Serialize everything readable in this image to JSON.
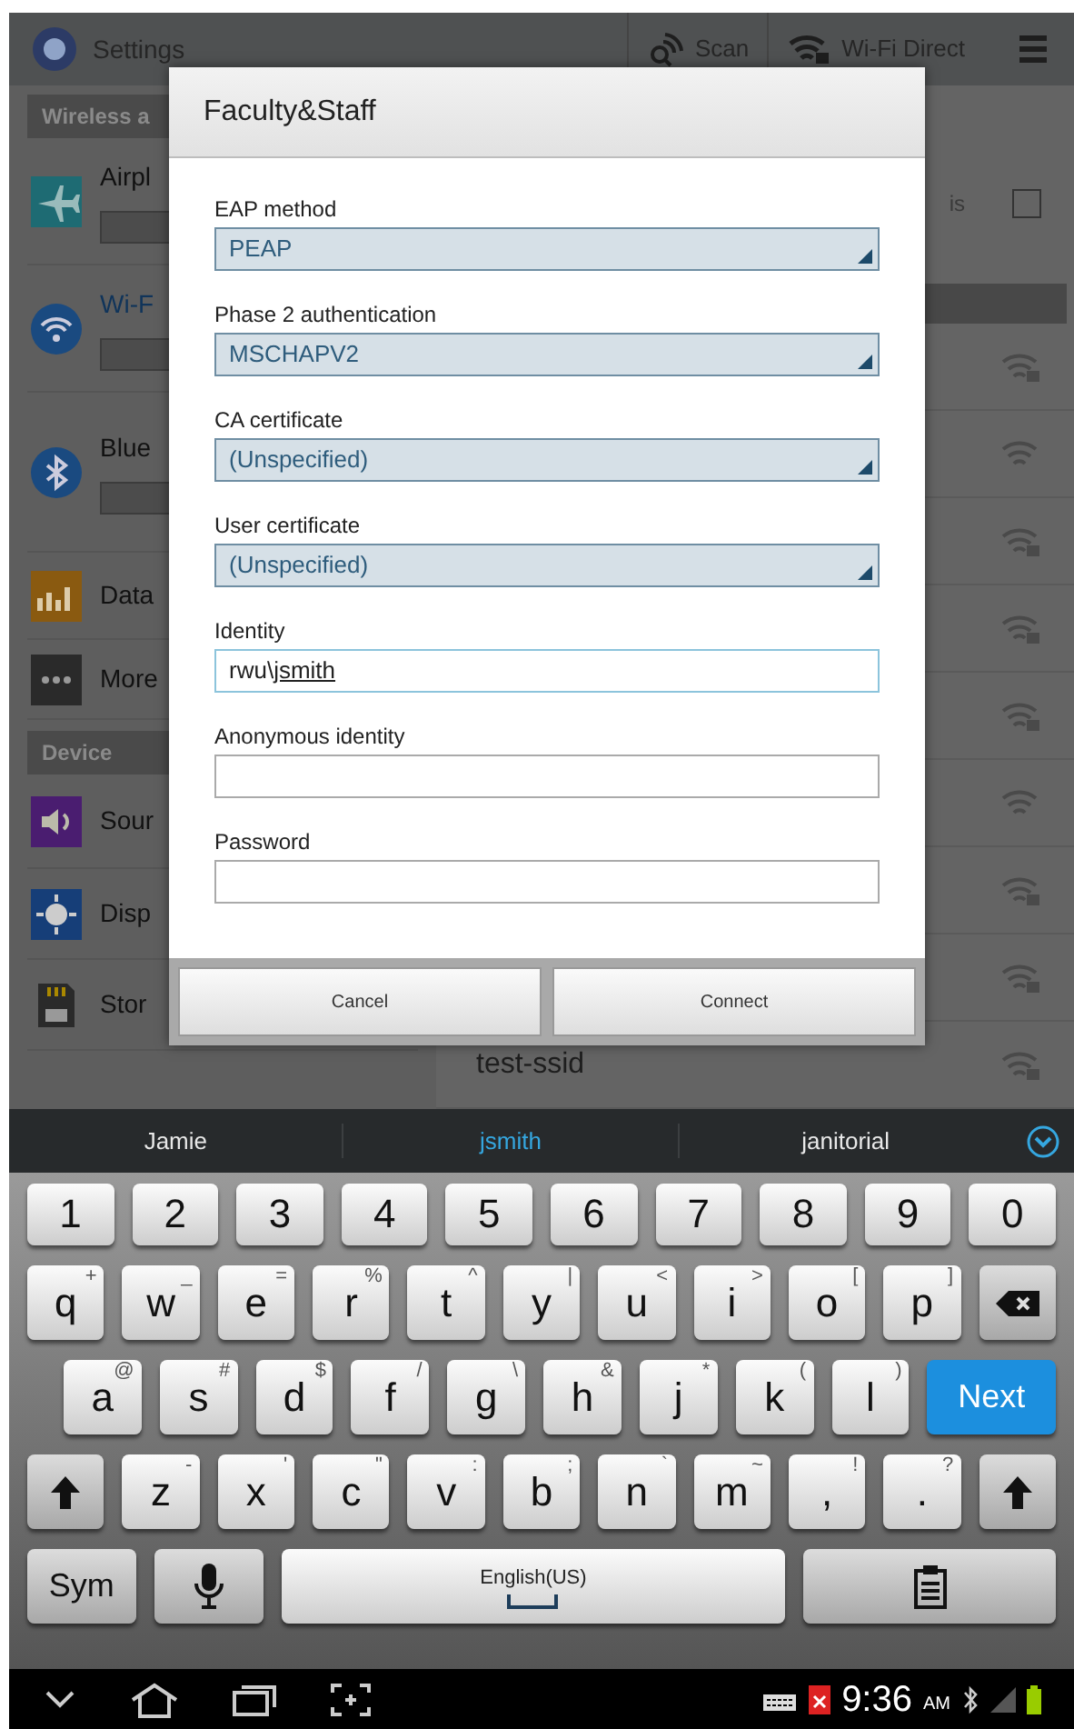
{
  "action_bar": {
    "title": "Settings",
    "actions": [
      {
        "kind": "scan",
        "label": "Scan"
      },
      {
        "kind": "wifi_direct",
        "label": "Wi-Fi Direct"
      }
    ]
  },
  "left_panel": {
    "sections": [
      {
        "header": "Wireless a",
        "items": [
          {
            "kind": "airplane",
            "label": "Airpl",
            "toggle": {
              "on": false
            }
          },
          {
            "kind": "wifi",
            "label": "Wi-F",
            "toggle": {
              "on": false
            }
          },
          {
            "kind": "bluetooth",
            "label": "Blue",
            "toggle": {
              "on": false
            }
          },
          {
            "kind": "data",
            "label": "Data"
          },
          {
            "kind": "more",
            "label": "More"
          }
        ]
      },
      {
        "header": "Device",
        "items": [
          {
            "kind": "sound",
            "label": "Sour"
          },
          {
            "kind": "display",
            "label": "Disp"
          },
          {
            "kind": "storage",
            "label": "Stor"
          }
        ]
      }
    ]
  },
  "right_panel": {
    "option": {
      "label": "is",
      "checked": false
    },
    "networks": [
      {
        "secured": true
      },
      {
        "secured": false
      },
      {
        "secured": true
      },
      {
        "secured": true
      },
      {
        "secured": true
      },
      {
        "secured": false
      },
      {
        "secured": true
      },
      {
        "secured": true
      },
      {
        "name": "test-ssid",
        "secured": true
      }
    ]
  },
  "dialog": {
    "title": "Faculty&Staff",
    "fields": [
      {
        "kind": "dropdown",
        "label": "EAP method",
        "value": "PEAP"
      },
      {
        "kind": "dropdown",
        "label": "Phase 2 authentication",
        "value": "MSCHAPV2"
      },
      {
        "kind": "dropdown",
        "label": "CA certificate",
        "value": "(Unspecified)"
      },
      {
        "kind": "dropdown",
        "label": "User certificate",
        "value": "(Unspecified)"
      },
      {
        "kind": "text",
        "label": "Identity",
        "value": "rwu\\",
        "composing": "jsmith",
        "focused": true
      },
      {
        "kind": "text",
        "label": "Anonymous identity",
        "focused": false
      },
      {
        "kind": "password",
        "label": "Password",
        "focused": false
      }
    ],
    "buttons": [
      "Cancel",
      "Connect"
    ]
  },
  "keyboard": {
    "suggestions": [
      {
        "text": "Jamie",
        "selected": false
      },
      {
        "text": "jsmith",
        "selected": true
      },
      {
        "text": "janitorial",
        "selected": false
      }
    ],
    "rows": [
      [
        {
          "kind": "char",
          "label": "1"
        },
        {
          "kind": "char",
          "label": "2"
        },
        {
          "kind": "char",
          "label": "3"
        },
        {
          "kind": "char",
          "label": "4"
        },
        {
          "kind": "char",
          "label": "5"
        },
        {
          "kind": "char",
          "label": "6"
        },
        {
          "kind": "char",
          "label": "7"
        },
        {
          "kind": "char",
          "label": "8"
        },
        {
          "kind": "char",
          "label": "9"
        },
        {
          "kind": "char",
          "label": "0"
        }
      ],
      [
        {
          "kind": "char",
          "label": "q",
          "alt": "+"
        },
        {
          "kind": "char",
          "label": "w",
          "alt": "_"
        },
        {
          "kind": "char",
          "label": "e",
          "alt": "="
        },
        {
          "kind": "char",
          "label": "r",
          "alt": "%"
        },
        {
          "kind": "char",
          "label": "t",
          "alt": "^"
        },
        {
          "kind": "char",
          "label": "y",
          "alt": "|"
        },
        {
          "kind": "char",
          "label": "u",
          "alt": "<"
        },
        {
          "kind": "char",
          "label": "i",
          "alt": ">"
        },
        {
          "kind": "char",
          "label": "o",
          "alt": "["
        },
        {
          "kind": "char",
          "label": "p",
          "alt": "]"
        },
        {
          "kind": "backspace"
        }
      ],
      [
        {
          "kind": "char",
          "label": "a",
          "alt": "@"
        },
        {
          "kind": "char",
          "label": "s",
          "alt": "#"
        },
        {
          "kind": "char",
          "label": "d",
          "alt": "$"
        },
        {
          "kind": "char",
          "label": "f",
          "alt": "/"
        },
        {
          "kind": "char",
          "label": "g",
          "alt": "\\"
        },
        {
          "kind": "char",
          "label": "h",
          "alt": "&"
        },
        {
          "kind": "char",
          "label": "j",
          "alt": "*"
        },
        {
          "kind": "char",
          "label": "k",
          "alt": "("
        },
        {
          "kind": "char",
          "label": "l",
          "alt": ")"
        },
        {
          "kind": "action",
          "label": "Next"
        }
      ],
      [
        {
          "kind": "shift"
        },
        {
          "kind": "char",
          "label": "z",
          "alt": "-"
        },
        {
          "kind": "char",
          "label": "x",
          "alt": "'"
        },
        {
          "kind": "char",
          "label": "c",
          "alt": "\""
        },
        {
          "kind": "char",
          "label": "v",
          "alt": ":"
        },
        {
          "kind": "char",
          "label": "b",
          "alt": ";"
        },
        {
          "kind": "char",
          "label": "n",
          "alt": "`"
        },
        {
          "kind": "char",
          "label": "m",
          "alt": "~"
        },
        {
          "kind": "char",
          "label": ",",
          "alt": "!"
        },
        {
          "kind": "char",
          "label": ".",
          "alt": "?"
        },
        {
          "kind": "shift"
        }
      ],
      [
        {
          "kind": "sym",
          "label": "Sym"
        },
        {
          "kind": "mic"
        },
        {
          "kind": "space",
          "label": "English(US)"
        },
        {
          "kind": "clipboard"
        }
      ]
    ]
  },
  "status_bar": {
    "time": "9:36",
    "meridiem": "AM"
  }
}
